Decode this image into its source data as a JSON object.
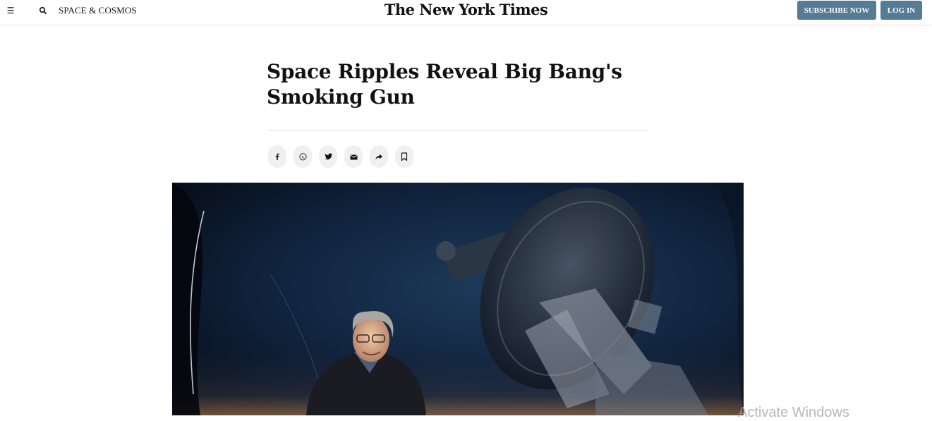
{
  "header": {
    "menu_icon": "hamburger-icon",
    "search_icon": "search-icon",
    "section_label": "SPACE & COSMOS",
    "logo_text": "The New York Times",
    "subscribe_label": "SUBSCRIBE NOW",
    "login_label": "LOG IN",
    "button_color": "#567b95"
  },
  "article": {
    "headline": "Space Ripples Reveal Big Bang's Smoking Gun",
    "share_buttons": [
      {
        "icon": "facebook-icon"
      },
      {
        "icon": "whatsapp-icon"
      },
      {
        "icon": "twitter-icon"
      },
      {
        "icon": "email-icon"
      },
      {
        "icon": "share-icon"
      },
      {
        "icon": "bookmark-icon"
      }
    ]
  },
  "overlay": {
    "watermark": "Activate Windows"
  }
}
